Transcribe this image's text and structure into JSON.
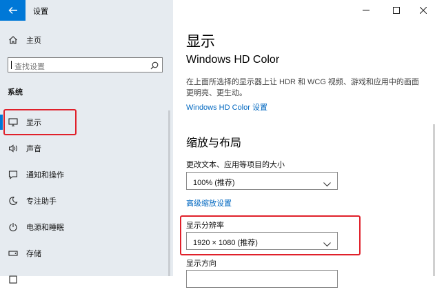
{
  "window": {
    "title": "设置"
  },
  "sidebar": {
    "home_label": "主页",
    "search_placeholder": "查找设置",
    "section": "系统",
    "items": [
      {
        "label": "显示",
        "icon": "monitor-icon"
      },
      {
        "label": "声音",
        "icon": "speaker-icon"
      },
      {
        "label": "通知和操作",
        "icon": "notification-icon"
      },
      {
        "label": "专注助手",
        "icon": "moon-icon"
      },
      {
        "label": "电源和睡眠",
        "icon": "power-icon"
      },
      {
        "label": "存储",
        "icon": "storage-icon"
      }
    ]
  },
  "main": {
    "title": "显示",
    "hd_color_heading": "Windows HD Color",
    "hd_color_desc": "在上面所选择的显示器上让 HDR 和 WCG 视频、游戏和应用中的画面更明亮、更生动。",
    "hd_color_link": "Windows HD Color 设置",
    "scale_heading": "缩放与布局",
    "scale_label": "更改文本、应用等项目的大小",
    "scale_value": "100% (推荐)",
    "advanced_scale_link": "高级缩放设置",
    "resolution_label": "显示分辨率",
    "resolution_value": "1920 × 1080 (推荐)",
    "orientation_label": "显示方向"
  },
  "colors": {
    "accent": "#0078d7",
    "highlight": "#e0202a",
    "link": "#0067c0",
    "sidebar_bg": "#e6ebf0"
  }
}
